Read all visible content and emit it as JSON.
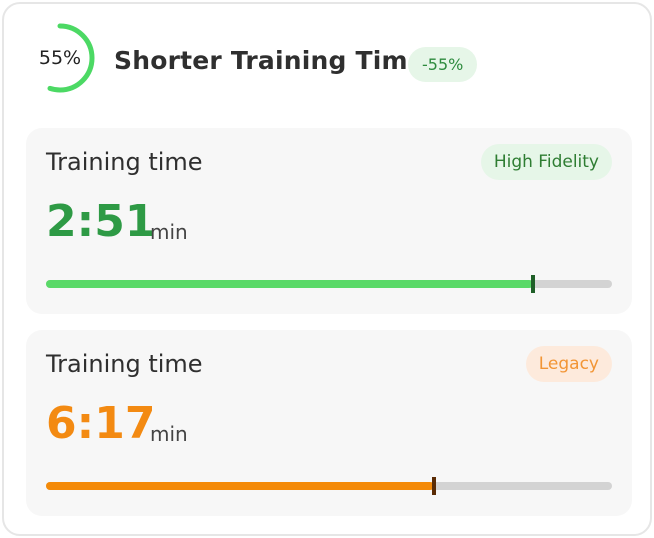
{
  "header": {
    "ring_label": "55%",
    "ring_progress": 0.55,
    "title": "Shorter Training Time",
    "delta_badge": "-55%"
  },
  "panels": [
    {
      "title": "Training time",
      "badge": "High Fidelity",
      "value": "2:51",
      "unit": "min",
      "progress": 0.86,
      "color": "#5ad968"
    },
    {
      "title": "Training time",
      "badge": "Legacy",
      "value": "6:17",
      "unit": "min",
      "progress": 0.686,
      "color": "#f48a08"
    }
  ],
  "colors": {
    "accent_green": "#2e9a45",
    "accent_orange": "#f38a12",
    "ring_green": "#4cd964"
  }
}
